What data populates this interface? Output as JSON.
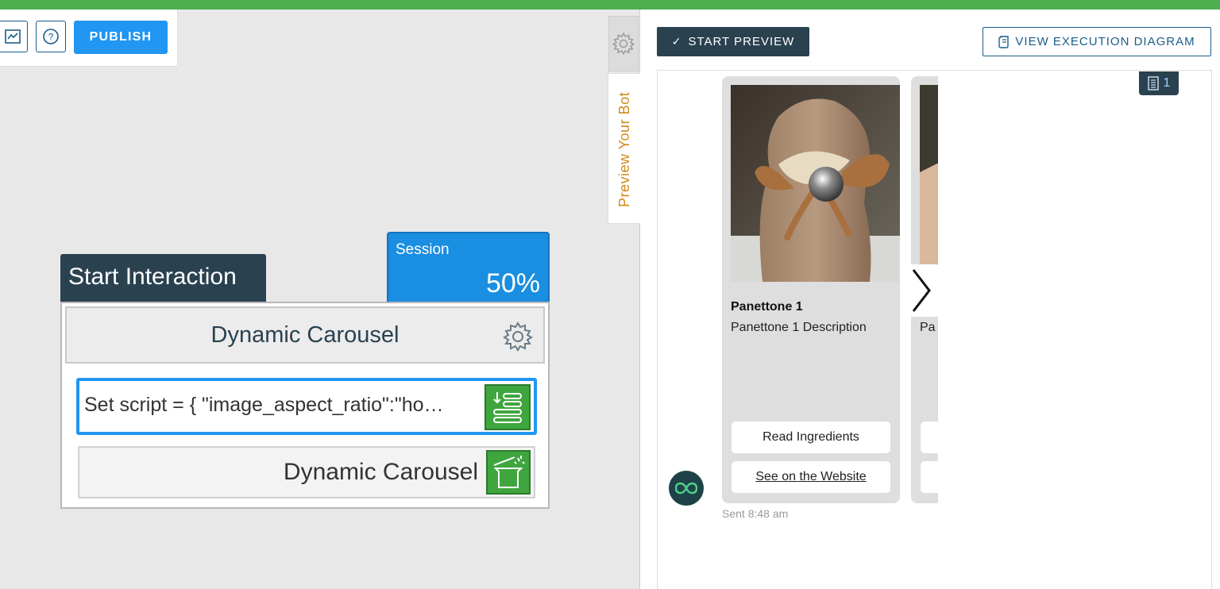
{
  "toolbar": {
    "chart_icon": "chart-icon",
    "help_icon": "help-icon",
    "publish_label": "PUBLISH"
  },
  "node": {
    "title": "Start Interaction",
    "session_label": "Session",
    "session_value": "50%",
    "header_label": "Dynamic Carousel",
    "script_text": "Set script = { \"image_aspect_ratio\":\"ho…",
    "carousel_label": "Dynamic Carousel"
  },
  "side_tabs": {
    "preview_label": "Preview Your Bot"
  },
  "preview": {
    "start_label": "START PREVIEW",
    "view_diagram_label": "VIEW EXECUTION DIAGRAM",
    "message_count": "1",
    "cards": [
      {
        "title": "Panettone 1",
        "description": "Panettone 1 Description",
        "button_1": "Read Ingredients",
        "button_2": "See on the Website"
      },
      {
        "title": "",
        "description": "Pa"
      }
    ],
    "sent_label": "Sent 8:48 am"
  },
  "colors": {
    "top_bar": "#4caf50",
    "publish": "#2196f3",
    "dark_navy": "#2a4150",
    "session": "#1a8ee0",
    "green_icon": "#3fa63f",
    "preview_tab_text": "#d08a1a"
  }
}
